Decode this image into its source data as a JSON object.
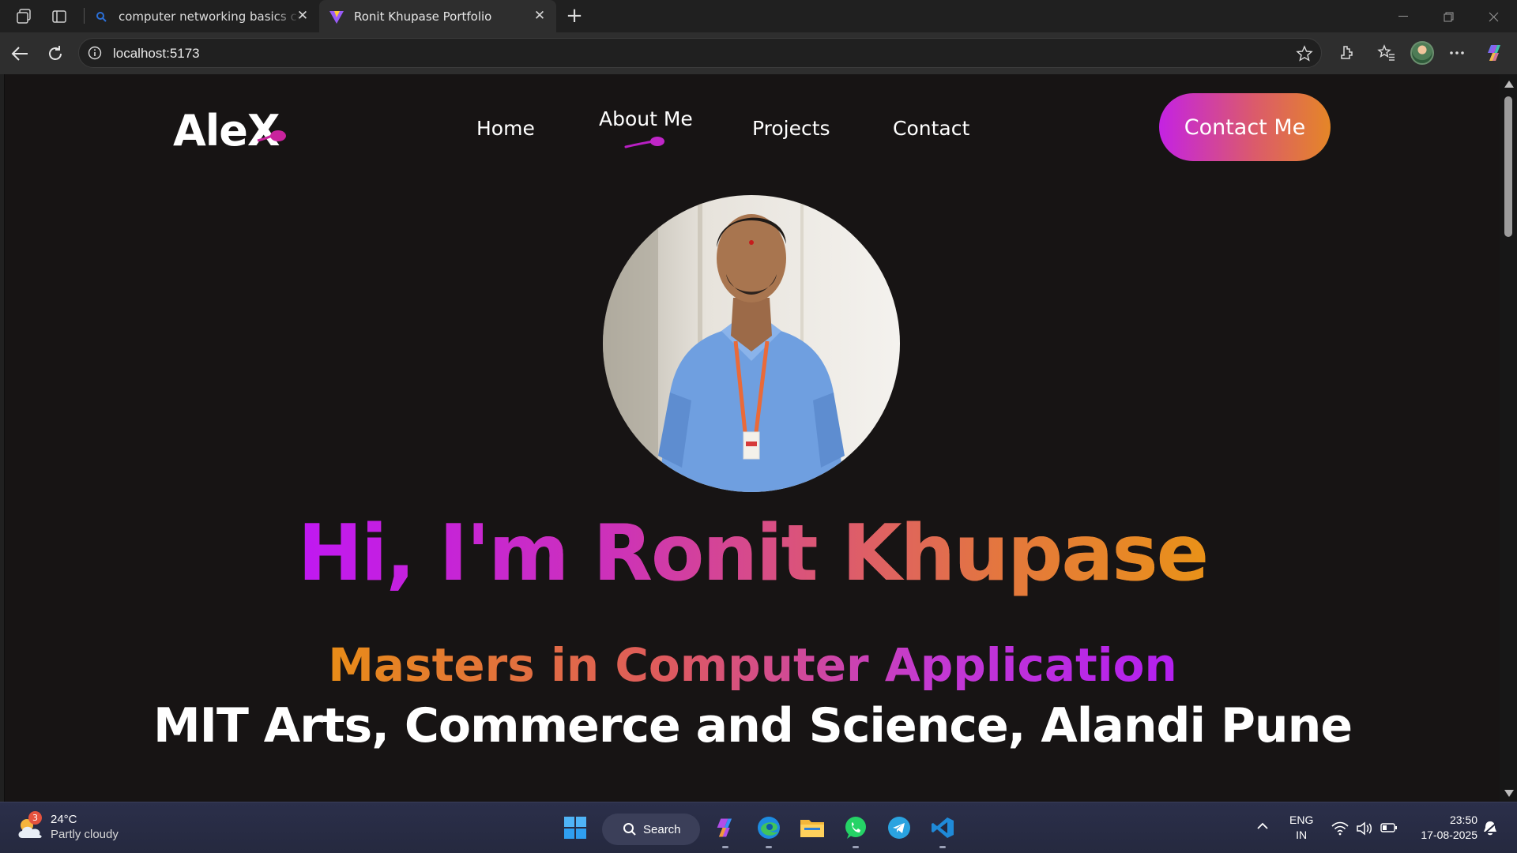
{
  "browser": {
    "tabs": [
      {
        "title": "computer networking basics conc",
        "active": false
      },
      {
        "title": "Ronit Khupase Portfolio",
        "active": true
      }
    ],
    "url": "localhost:5173"
  },
  "page": {
    "logo": "AleX",
    "nav": {
      "home": "Home",
      "about": "About Me",
      "projects": "Projects",
      "contact": "Contact"
    },
    "cta_label": "Contact Me",
    "hero": {
      "headline": "Hi, I'm Ronit Khupase",
      "degree": "Masters in Computer Application",
      "college": "MIT Arts, Commerce and Science, Alandi Pune"
    },
    "colors": {
      "background": "#171414",
      "accent_purple": "#c018f2",
      "accent_orange": "#e99218"
    }
  },
  "taskbar": {
    "weather_temp": "24°C",
    "weather_condition": "Partly cloudy",
    "weather_badge": "3",
    "search_label": "Search",
    "lang_line1": "ENG",
    "lang_line2": "IN",
    "time": "23:50",
    "date": "17-08-2025"
  }
}
